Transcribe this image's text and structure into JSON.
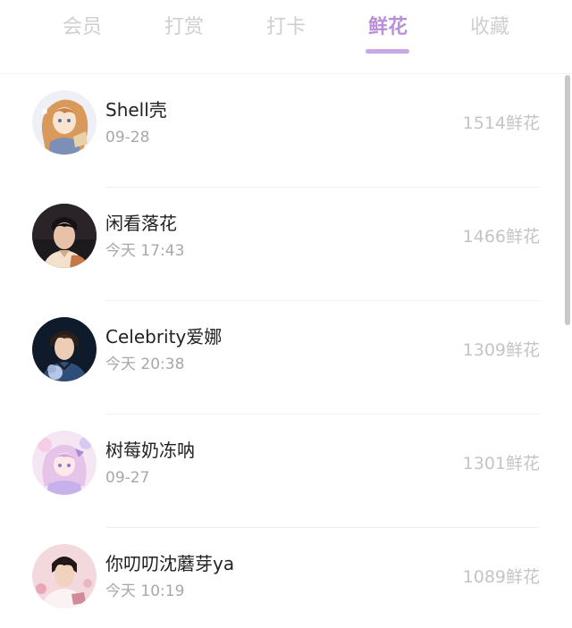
{
  "tabs": [
    {
      "label": "会员",
      "active": false
    },
    {
      "label": "打赏",
      "active": false
    },
    {
      "label": "打卡",
      "active": false
    },
    {
      "label": "鲜花",
      "active": true
    },
    {
      "label": "收藏",
      "active": false
    }
  ],
  "colors": {
    "active_tab": "#b98fd9",
    "inactive_tab": "#cfcfcf",
    "name_text": "#222222",
    "secondary_text": "#a8a8a8",
    "count_text": "#c4c4c4"
  },
  "list": [
    {
      "name": "Shell壳",
      "time": "09-28",
      "count": "1514鲜花",
      "avatar": "anime-girl-avatar"
    },
    {
      "name": "闲看落花",
      "time": "今天 17:43",
      "count": "1466鲜花",
      "avatar": "photo-avatar"
    },
    {
      "name": "Celebrity爱娜",
      "time": "今天 20:38",
      "count": "1309鲜花",
      "avatar": "photo-avatar"
    },
    {
      "name": "树莓奶冻呐",
      "time": "09-27",
      "count": "1301鲜花",
      "avatar": "anime-girl-avatar"
    },
    {
      "name": "你叨叨沈蘑芽ya",
      "time": "今天 10:19",
      "count": "1089鲜花",
      "avatar": "photo-avatar"
    }
  ]
}
